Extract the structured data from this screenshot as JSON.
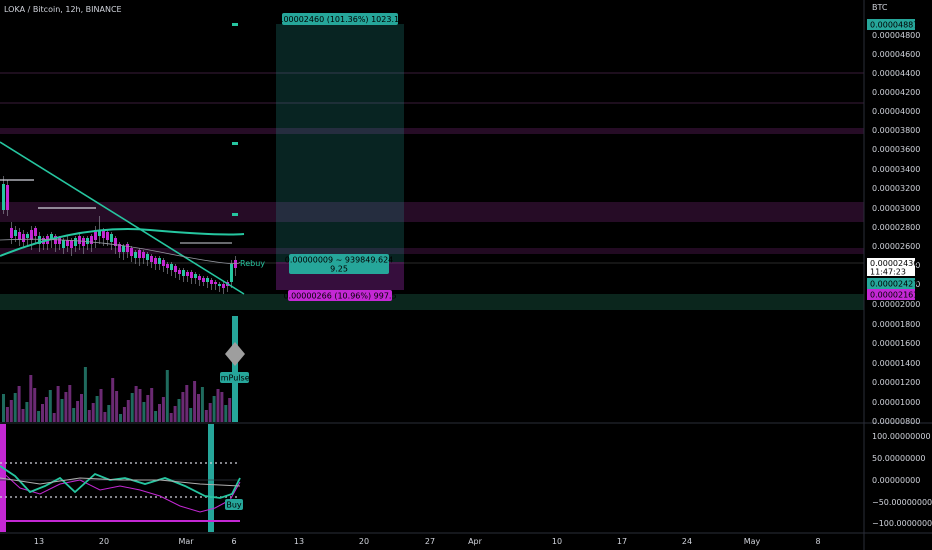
{
  "header": {
    "symbol_title": "LOKA / Bitcoin, 12h, BINANCE"
  },
  "price_axis": {
    "currency": "BTC",
    "ticks": [
      "0.00004887",
      "0.00004800",
      "0.00004600",
      "0.00004400",
      "0.00004200",
      "0.00004000",
      "0.00003800",
      "0.00003600",
      "0.00003400",
      "0.00003200",
      "0.00003000",
      "0.00002800",
      "0.00002600",
      "0.00002400",
      "0.00002200",
      "0.00002000",
      "0.00001800",
      "0.00001600",
      "0.00001400",
      "0.00001200",
      "0.00001000",
      "0.00000800"
    ],
    "current_price": "0.00002436",
    "countdown": "11:47:23",
    "tag_green": "0.00002427",
    "tag_purple": "0.00002161"
  },
  "oscillator_axis": {
    "ticks": [
      "100.00000000",
      "50.00000000",
      "0.00000000",
      "−50.00000000",
      "−100.00000000"
    ]
  },
  "time_axis": {
    "labels": [
      "13",
      "20",
      "Mar",
      "6",
      "13",
      "20",
      "27",
      "Apr",
      "10",
      "17",
      "24",
      "May",
      "8"
    ]
  },
  "position_tool": {
    "target_label": "0.00002460 (101.36%) 1023.12",
    "center_label_line1": "0.00000009 ~ 939849.624",
    "center_label_line2": "9.25",
    "stop_label": "0.00000266 (10.96%) 997.5"
  },
  "markers": {
    "impulse_label": "ImPulse",
    "buy_label": "Buy",
    "small_label": "Rebuy"
  },
  "colors": {
    "background": "#000000",
    "teal": "#26c6a0",
    "purple": "#c428d4",
    "target_zone": "#26a69a",
    "stop_zone": "#9c27b0"
  },
  "chart_data": {
    "type": "candlestick",
    "price_range": [
      8e-06,
      4.887e-05
    ],
    "oscillator_range": [
      -100,
      100
    ],
    "x_labels": [
      "13",
      "20",
      "Mar",
      "6",
      "13",
      "20",
      "27",
      "Apr",
      "10",
      "17",
      "24",
      "May",
      "8"
    ],
    "last_price": 2.436e-05
  }
}
